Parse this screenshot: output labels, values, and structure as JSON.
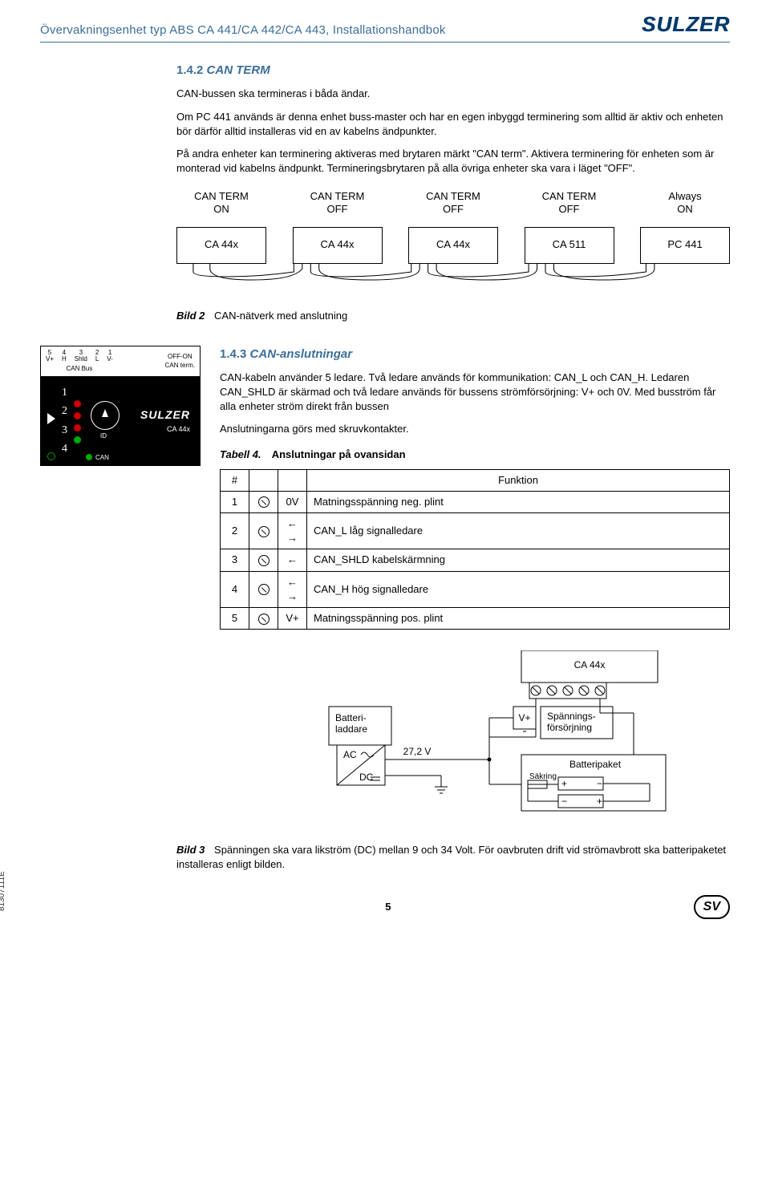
{
  "header": {
    "title": "Övervakningsenhet typ ABS CA 441/CA 442/CA 443, Installationshandbok",
    "brand": "SULZER"
  },
  "sec142": {
    "num": "1.4.2",
    "title": "CAN TERM",
    "p1": "CAN-bussen ska termineras i båda ändar.",
    "p2": "Om PC 441 används är denna enhet buss-master och har en egen inbyggd terminering som alltid är aktiv och enheten bör därför alltid installeras vid en av kabelns ändpunkter.",
    "p3": "På andra enheter kan terminering aktiveras med brytaren märkt \"CAN term\". Aktivera terminering för enheten som är monterad vid kabelns ändpunkt. Termineringsbrytaren på alla övriga enheter ska vara i läget \"OFF\"."
  },
  "net": {
    "nodes": [
      {
        "label1": "CAN TERM",
        "label2": "ON",
        "box": "CA 44x"
      },
      {
        "label1": "CAN TERM",
        "label2": "OFF",
        "box": "CA 44x"
      },
      {
        "label1": "CAN TERM",
        "label2": "OFF",
        "box": "CA 44x"
      },
      {
        "label1": "CAN TERM",
        "label2": "OFF",
        "box": "CA 511"
      },
      {
        "label1": "Always",
        "label2": "ON",
        "box": "PC 441"
      }
    ]
  },
  "bild2": {
    "num": "Bild 2",
    "text": "CAN-nätverk med anslutning"
  },
  "device": {
    "pins": [
      {
        "n": "5",
        "l": "V+"
      },
      {
        "n": "4",
        "l": "H"
      },
      {
        "n": "3",
        "l": "Shld"
      },
      {
        "n": "2",
        "l": "L"
      },
      {
        "n": "1",
        "l": "V-"
      }
    ],
    "can_bus_label": "CAN Bus",
    "term_label_1": "OFF-ON",
    "term_label_2": "CAN term.",
    "numbers": [
      "1",
      "2",
      "3",
      "4"
    ],
    "id_label": "ID",
    "can_label": "CAN",
    "brand": "SULZER",
    "model": "CA 44x"
  },
  "sec143": {
    "num": "1.4.3",
    "title": "CAN-anslutningar",
    "p1": "CAN-kabeln använder 5 ledare. Två ledare används för kommunikation: CAN_L och CAN_H. Ledaren CAN_SHLD är skärmad och två ledare används för bussens strömförsörjning: V+ och 0V. Med busström får alla enheter ström direkt från bussen",
    "p2": "Anslutningarna görs med skruvkontakter."
  },
  "tabell4": {
    "label_num": "Tabell 4.",
    "label_text": "Anslutningar på ovansidan",
    "head_hash": "#",
    "head_func": "Funktion",
    "rows": [
      {
        "n": "1",
        "sym": "0V",
        "arrows": "",
        "func": "Matningsspänning neg. plint"
      },
      {
        "n": "2",
        "sym": "",
        "arrows": "← →",
        "func": "CAN_L låg signalledare"
      },
      {
        "n": "3",
        "sym": "",
        "arrows": "←",
        "func": "CAN_SHLD kabelskärmning"
      },
      {
        "n": "4",
        "sym": "",
        "arrows": "← →",
        "func": "CAN_H hög signalledare"
      },
      {
        "n": "5",
        "sym": "V+",
        "arrows": "",
        "func": "Matningsspänning pos. plint"
      }
    ]
  },
  "wiring": {
    "ca44x": "CA 44x",
    "batteriladdare": "Batteri-\nladdare",
    "ac": "AC",
    "dc": "DC",
    "volt": "27,2 V",
    "vplus": "V+",
    "psu": "Spännings-\nförsörjning",
    "battery_pack": "Batteripaket",
    "fuse": "Säkring"
  },
  "bild3": {
    "num": "Bild 3",
    "text": "Spänningen ska vara likström (DC) mellan 9 och 34 Volt. För oavbruten drift vid strömavbrott ska batteripaketet installeras enligt bilden."
  },
  "footer": {
    "side_code": "81307111E",
    "page": "5",
    "lang_badge": "SV"
  }
}
